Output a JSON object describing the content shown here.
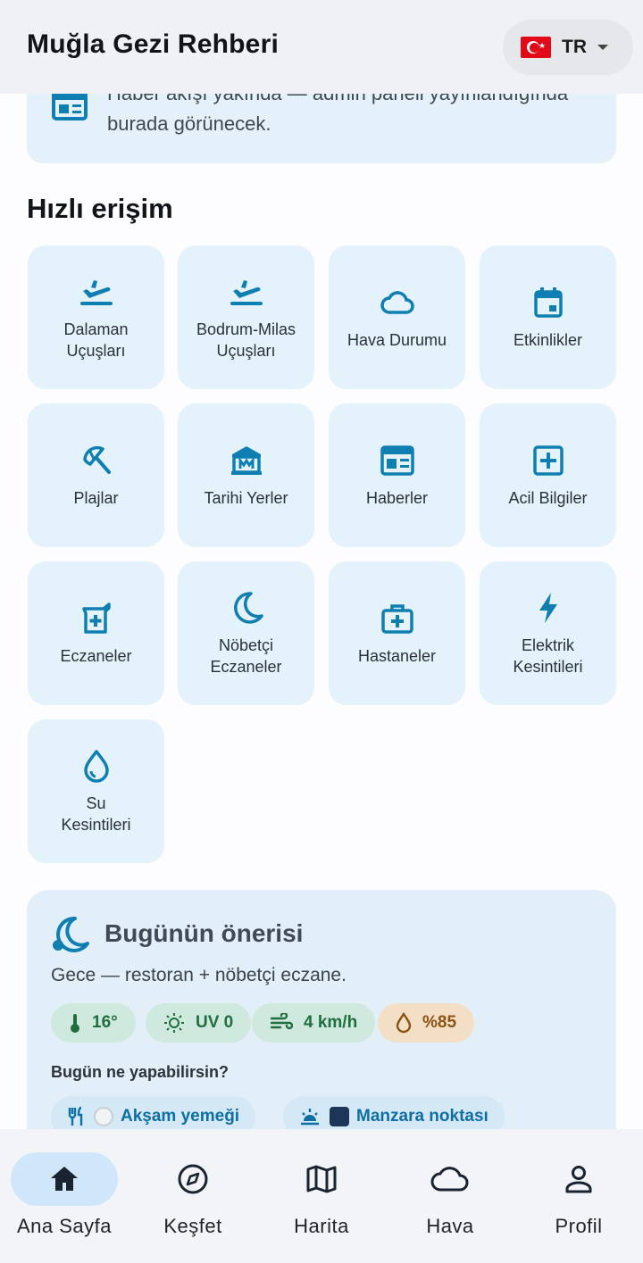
{
  "app": {
    "title": "Muğla Gezi Rehberi"
  },
  "language": {
    "code": "TR",
    "flag_icon": "turkey-flag-icon"
  },
  "news": {
    "text": "Haber akışı yakında — admin paneli yayınlandığında burada görünecek.",
    "icon": "newspaper-icon"
  },
  "quick_access": {
    "title": "Hızlı erişim",
    "items": [
      {
        "label": "Dalaman\nUçuşları",
        "icon": "flight-icon"
      },
      {
        "label": "Bodrum-Milas\nUçuşları",
        "icon": "flight-icon"
      },
      {
        "label": "Hava Durumu",
        "icon": "cloud-icon"
      },
      {
        "label": "Etkinlikler",
        "icon": "calendar-icon"
      },
      {
        "label": "Plajlar",
        "icon": "umbrella-icon"
      },
      {
        "label": "Tarihi Yerler",
        "icon": "museum-icon"
      },
      {
        "label": "Haberler",
        "icon": "newspaper-icon"
      },
      {
        "label": "Acil Bilgiler",
        "icon": "medical-plus-icon"
      },
      {
        "label": "Eczaneler",
        "icon": "pharmacy-icon"
      },
      {
        "label": "Nöbetçi\nEczaneler",
        "icon": "moon-icon"
      },
      {
        "label": "Hastaneler",
        "icon": "medical-bag-icon"
      },
      {
        "label": "Elektrik\nKesintileri",
        "icon": "bolt-icon"
      },
      {
        "label": "Su\nKesintileri",
        "icon": "water-drop-icon"
      }
    ]
  },
  "recommendation": {
    "title": "Bugünün önerisi",
    "subtitle": "Gece — restoran + nöbetçi eczane.",
    "chips": [
      {
        "label": "16°",
        "icon": "thermometer-icon"
      },
      {
        "label": "UV 0",
        "icon": "sun-icon"
      },
      {
        "label": "4 km/h",
        "icon": "wind-icon"
      },
      {
        "label": "%85",
        "icon": "humidity-icon"
      }
    ],
    "question": "Bugün ne yapabilirsin?",
    "actions": [
      {
        "label": "Akşam yemeği",
        "icon": "restaurant-icon"
      },
      {
        "label": "Manzara noktası",
        "icon": "sunset-icon"
      }
    ]
  },
  "bottom_nav": {
    "items": [
      {
        "label": "Ana Sayfa",
        "icon": "home-icon",
        "active": true
      },
      {
        "label": "Keşfet",
        "icon": "compass-icon"
      },
      {
        "label": "Harita",
        "icon": "map-icon"
      },
      {
        "label": "Hava",
        "icon": "cloud-icon"
      },
      {
        "label": "Profil",
        "icon": "person-icon"
      }
    ]
  },
  "colors": {
    "accent": "#0e7fb0",
    "tile_bg": "#e4f2fc",
    "active_pill": "#cfe6fb"
  }
}
